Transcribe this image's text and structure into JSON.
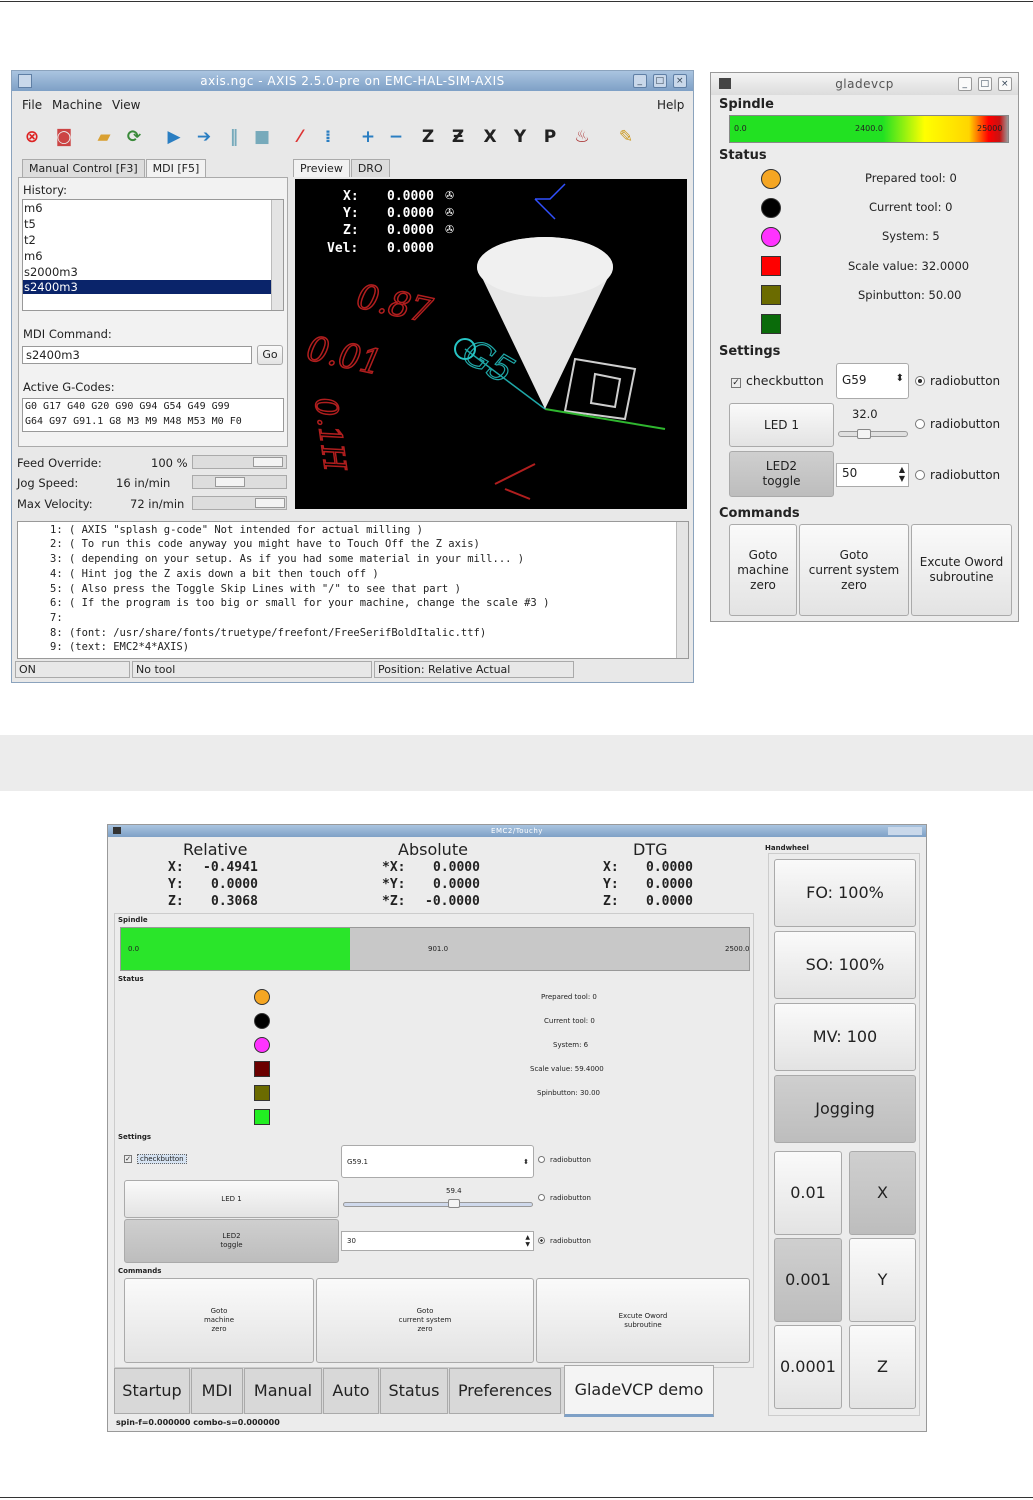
{
  "axis_window": {
    "title": "axis.ngc - AXIS 2.5.0-pre on EMC-HAL-SIM-AXIS",
    "menu": [
      "File",
      "Machine",
      "View"
    ],
    "help": "Help",
    "tabs_left": [
      "Manual Control [F3]",
      "MDI [F5]"
    ],
    "tabs_right": [
      "Preview",
      "DRO"
    ],
    "history_label": "History:",
    "history": [
      "m6",
      "t5",
      "t2",
      "m6",
      "s2000m3",
      "s2400m3"
    ],
    "mdi_command_label": "MDI Command:",
    "mdi_command_value": "s2400m3",
    "go_label": "Go",
    "active_gcodes_label": "Active G-Codes:",
    "active_gcodes": [
      "G0 G17 G40 G20 G90 G94 G54 G49 G99",
      "G64 G97 G91.1 G8 M3 M9 M48 M53 M0 F0"
    ],
    "feed_override_label": "Feed Override:",
    "feed_override_value": "100 %",
    "jog_speed_label": "Jog Speed:",
    "jog_speed_value": "16 in/min",
    "max_velocity_label": "Max Velocity:",
    "max_velocity_value": "72 in/min",
    "dro": [
      {
        "axis": "X:",
        "value": "0.0000"
      },
      {
        "axis": "Y:",
        "value": "0.0000"
      },
      {
        "axis": "Z:",
        "value": "0.0000"
      },
      {
        "axis": "Vel:",
        "value": "0.0000"
      }
    ],
    "gcode_lines": [
      "1: ( AXIS \"splash g-code\" Not intended for actual milling )",
      "2: ( To run this code anyway you might have to Touch Off the Z axis)",
      "3: ( depending on your setup. As if you had some material in your mill... )",
      "4: ( Hint jog the Z axis down a bit then touch off )",
      "5: ( Also press the Toggle Skip Lines with \"/\" to see that part )",
      "6: ( If the program is too big or small for your machine, change the scale #3 )",
      "7:",
      "8: (font: /usr/share/fonts/truetype/freefont/FreeSerifBoldItalic.ttf)",
      "9: (text: EMC2*4*AXIS)"
    ],
    "status_bar": [
      "ON",
      "No tool",
      "Position: Relative Actual"
    ]
  },
  "gladevcp_window": {
    "title": "gladevcp",
    "spindle_label": "Spindle",
    "spindle_ticks": [
      "0.0",
      "2400.0",
      "25000"
    ],
    "spindle_fraction": 0.58,
    "status_label": "Status",
    "status_items": [
      "Prepared tool: 0",
      "Current tool: 0",
      "System: 5",
      "Scale value: 32.0000",
      "Spinbutton: 50.00"
    ],
    "status_colors": [
      "#f5a623",
      "#000000",
      "#ff33ff",
      "#ff0000",
      "#6b6b00",
      "#0a6b0a"
    ],
    "settings_label": "Settings",
    "checkbutton_label": "checkbutton",
    "combo_value": "G59",
    "radiobutton_label": "radiobutton",
    "led1_label": "LED 1",
    "scale_value": "32.0",
    "led2_label": "LED2\ntoggle",
    "spin_value": "50",
    "commands_label": "Commands",
    "cmd_buttons": [
      "Goto\nmachine\nzero",
      "Goto\ncurrent system\nzero",
      "Excute Oword\nsubroutine"
    ]
  },
  "touchy_window": {
    "title": "EMC2/Touchy",
    "col_relative": "Relative",
    "col_absolute": "Absolute",
    "col_dtg": "DTG",
    "relative": [
      {
        "axis": "X:",
        "value": "-0.4941"
      },
      {
        "axis": "Y:",
        "value": "0.0000"
      },
      {
        "axis": "Z:",
        "value": "0.3068"
      }
    ],
    "absolute": [
      {
        "axis": "*X:",
        "value": "0.0000"
      },
      {
        "axis": "*Y:",
        "value": "0.0000"
      },
      {
        "axis": "*Z:",
        "value": "-0.0000"
      }
    ],
    "dtg": [
      {
        "axis": "X:",
        "value": "0.0000"
      },
      {
        "axis": "Y:",
        "value": "0.0000"
      },
      {
        "axis": "Z:",
        "value": "0.0000"
      }
    ],
    "spindle_label": "Spindle",
    "spindle_ticks": [
      "0.0",
      "901.0",
      "2500.0"
    ],
    "spindle_fraction": 0.37,
    "status_label": "Status",
    "status_items": [
      "Prepared tool: 0",
      "Current tool: 0",
      "System: 6",
      "Scale value: 59.4000",
      "Spinbutton: 30.00"
    ],
    "status_colors": [
      "#f5a623",
      "#000000",
      "#ff33ff",
      "#6b0000",
      "#6b6b00",
      "#22ee22"
    ],
    "settings_label": "Settings",
    "checkbutton_label": "checkbutton",
    "combo_value": "G59.1",
    "radiobutton_label": "radiobutton",
    "led1_label": "LED 1",
    "scale_value": "59.4",
    "led2_label": "LED2\ntoggle",
    "spin_value": "30",
    "commands_label": "Commands",
    "cmd_buttons": [
      "Goto\nmachine\nzero",
      "Goto\ncurrent system\nzero",
      "Excute Oword\nsubroutine"
    ],
    "tabs": [
      "Startup",
      "MDI",
      "Manual",
      "Auto",
      "Status",
      "Preferences",
      "GladeVCP demo"
    ],
    "status_line": "spin-f=0.000000 combo-s=0.000000",
    "handwheel_label": "Handwheel",
    "hw_buttons": [
      "FO: 100%",
      "SO: 100%",
      "MV: 100",
      "Jogging"
    ],
    "increments": [
      "0.01",
      "0.001",
      "0.0001"
    ],
    "axes": [
      "X",
      "Y",
      "Z"
    ]
  }
}
